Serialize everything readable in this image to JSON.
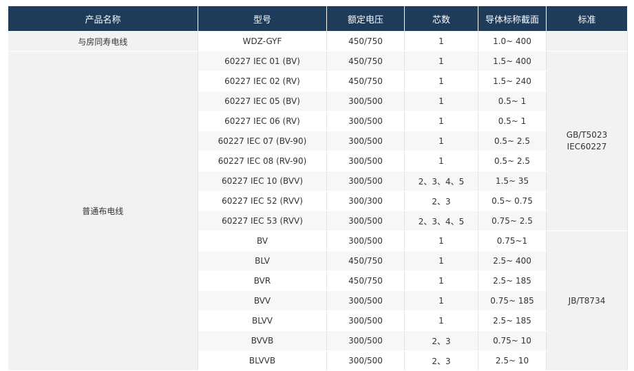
{
  "headers": [
    "产品名称",
    "型号",
    "额定电压",
    "芯数",
    "导体标称截面",
    "标准"
  ],
  "group_single": {
    "name": "与房同寿电线",
    "model": "WDZ-GYF",
    "voltage": "450/750",
    "cores": "1",
    "section": "1.0~ 400"
  },
  "group_common_name": "普通布电线",
  "standard_gb": [
    "GB/T5023",
    "IEC60227"
  ],
  "standard_jb": "JB/T8734",
  "rows": [
    {
      "model": "60227 IEC 01 (BV)",
      "voltage": "450/750",
      "cores": "1",
      "section": "1.5~ 400"
    },
    {
      "model": "60227 IEC 02 (RV)",
      "voltage": "450/750",
      "cores": "1",
      "section": "1.5~ 240"
    },
    {
      "model": "60227 IEC 05 (BV)",
      "voltage": "300/500",
      "cores": "1",
      "section": "0.5~ 1"
    },
    {
      "model": "60227 IEC 06 (RV)",
      "voltage": "300/500",
      "cores": "1",
      "section": "0.5~ 1"
    },
    {
      "model": "60227 IEC 07 (BV-90)",
      "voltage": "300/500",
      "cores": "1",
      "section": "0.5~ 2.5"
    },
    {
      "model": "60227 IEC 08 (RV-90)",
      "voltage": "300/500",
      "cores": "1",
      "section": "0.5~ 2.5"
    },
    {
      "model": "60227 IEC 10 (BVV)",
      "voltage": "300/500",
      "cores": "2、3、4、5",
      "section": "1.5~ 35"
    },
    {
      "model": "60227 IEC 52 (RVV)",
      "voltage": "300/300",
      "cores": "2、3",
      "section": "0.5~ 0.75"
    },
    {
      "model": "60227 IEC 53 (RVV)",
      "voltage": "300/500",
      "cores": "2、3、4、5",
      "section": "0.75~ 2.5"
    },
    {
      "model": "BV",
      "voltage": "300/500",
      "cores": "1",
      "section": "0.75~1"
    },
    {
      "model": "BLV",
      "voltage": "450/750",
      "cores": "1",
      "section": "2.5~ 400"
    },
    {
      "model": "BVR",
      "voltage": "450/750",
      "cores": "1",
      "section": "2.5~ 185"
    },
    {
      "model": "BVV",
      "voltage": "300/500",
      "cores": "1",
      "section": "0.75~ 185"
    },
    {
      "model": "BLVV",
      "voltage": "300/500",
      "cores": "1",
      "section": "2.5~ 185"
    },
    {
      "model": "BVVB",
      "voltage": "300/500",
      "cores": "2、3",
      "section": "0.75~ 10"
    },
    {
      "model": "BLVVB",
      "voltage": "300/500",
      "cores": "2、3",
      "section": "2.5~ 10"
    }
  ]
}
